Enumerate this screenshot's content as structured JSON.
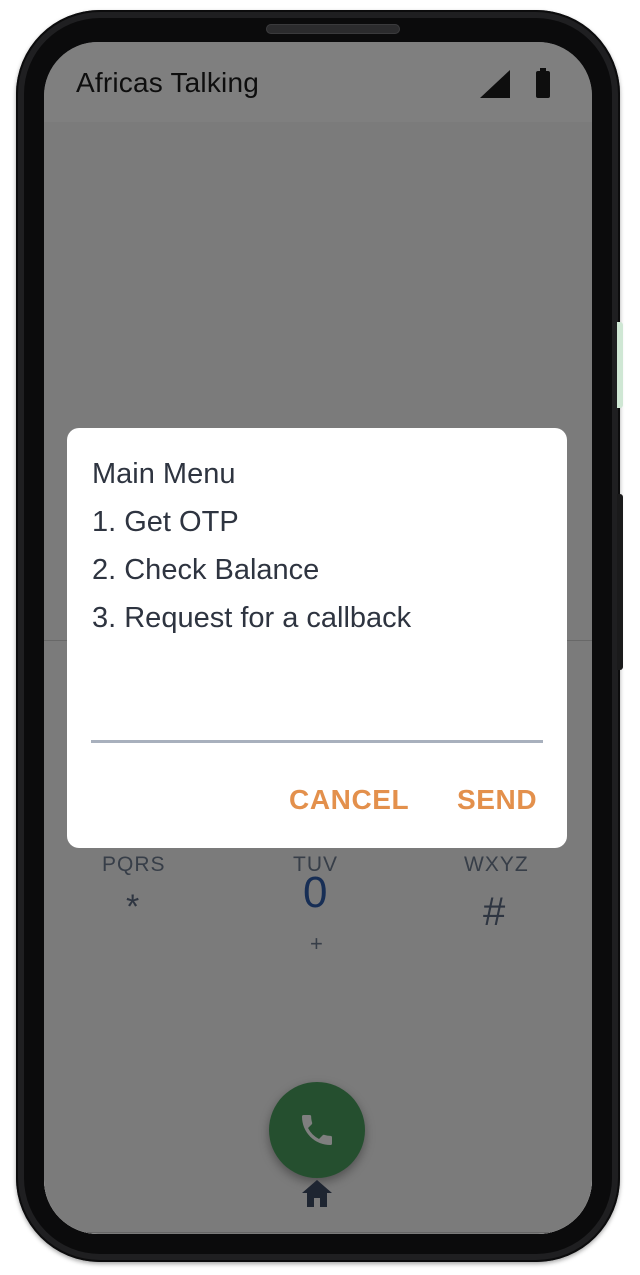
{
  "status_bar": {
    "app_title": "Africas Talking",
    "signal_icon": "cellular-signal-icon",
    "battery_icon": "battery-icon"
  },
  "dialpad": {
    "keys": [
      {
        "letters": "PQRS",
        "symbol": "*"
      },
      {
        "letters": "TUV",
        "symbol": "0",
        "sub": "+"
      },
      {
        "letters": "WXYZ",
        "symbol": "#"
      }
    ],
    "call_icon": "phone-icon",
    "call_color": "#4a9f5e"
  },
  "nav": {
    "home_icon": "home-icon"
  },
  "dialog": {
    "lines": [
      "Main Menu",
      "1. Get OTP",
      "2. Check Balance",
      "3. Request for a callback"
    ],
    "input_value": "",
    "cancel_label": "CANCEL",
    "send_label": "SEND",
    "accent_color": "#e3904c"
  }
}
